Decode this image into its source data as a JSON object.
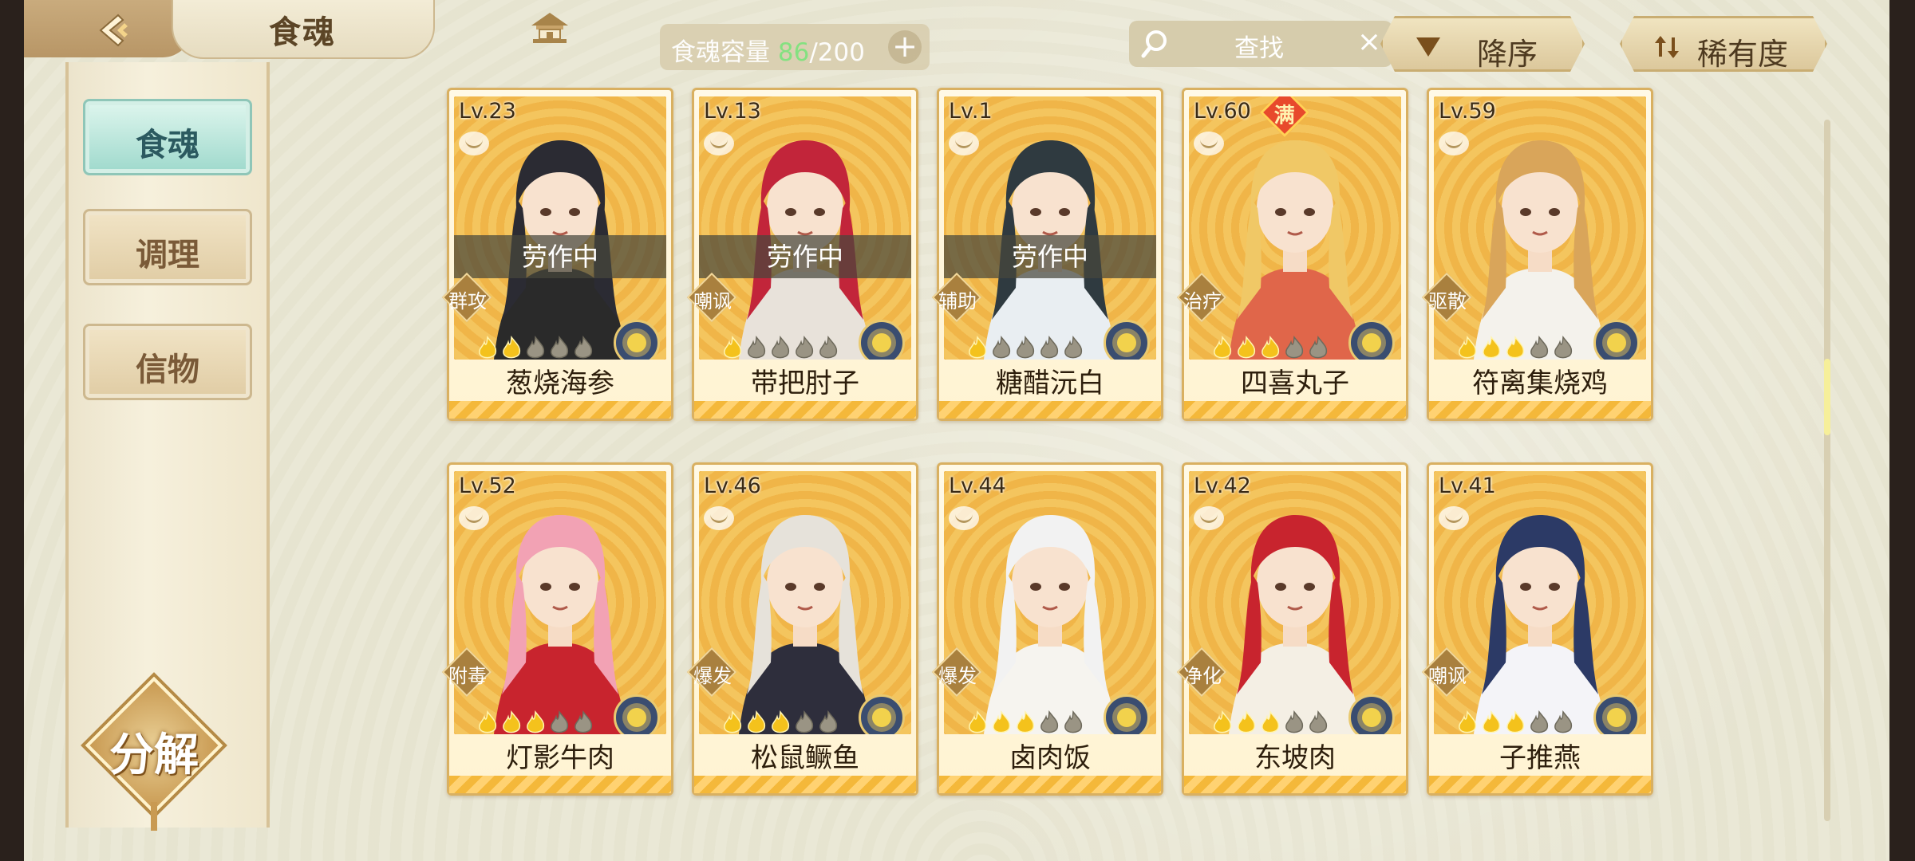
{
  "header": {
    "title": "食魂",
    "capacity_label": "食魂容量",
    "capacity_current": "86",
    "capacity_max": "/200",
    "capacity_add": "+",
    "search_placeholder": "查找",
    "search_clear": "×",
    "sort_order_label": "降序",
    "sort_key_label": "稀有度"
  },
  "sidebar": {
    "items": [
      {
        "label": "食魂",
        "active": true
      },
      {
        "label": "调理",
        "active": false
      },
      {
        "label": "信物",
        "active": false
      }
    ],
    "decompose_label": "分解"
  },
  "colors": {
    "capacity_current": "#7ce17a",
    "active_tab": "#9ed9cc",
    "card_border": "#d9b061",
    "full_badge": "#e84a2c",
    "art_background": "#f4c55e"
  },
  "cards": [
    {
      "level": "Lv.23",
      "name": "葱烧海参",
      "role": "群攻",
      "status": "劳作中",
      "stars": 2,
      "max_stars": 5,
      "full_badge": "",
      "hair": "#2b2b33",
      "outfit": "#2a2a2a",
      "emblem_color": "#3a4d70"
    },
    {
      "level": "Lv.13",
      "name": "带把肘子",
      "role": "嘲讽",
      "status": "劳作中",
      "stars": 1,
      "max_stars": 5,
      "full_badge": "",
      "hair": "#c2253a",
      "outfit": "#e8e2da",
      "emblem_color": "#3a4d70"
    },
    {
      "level": "Lv.1",
      "name": "糖醋沅白",
      "role": "辅助",
      "status": "劳作中",
      "stars": 1,
      "max_stars": 5,
      "full_badge": "",
      "hair": "#2f3a40",
      "outfit": "#e9eef2",
      "emblem_color": "#3a4d70"
    },
    {
      "level": "Lv.60",
      "name": "四喜丸子",
      "role": "治疗",
      "status": "",
      "stars": 3,
      "max_stars": 5,
      "full_badge": "满",
      "hair": "#f0c866",
      "outfit": "#e0664a",
      "emblem_color": "#3a4d70"
    },
    {
      "level": "Lv.59",
      "name": "符离集烧鸡",
      "role": "驱散",
      "status": "",
      "stars": 3,
      "max_stars": 5,
      "full_badge": "",
      "hair": "#d9a55a",
      "outfit": "#f4f2ec",
      "emblem_color": "#3a4d70"
    },
    {
      "level": "Lv.52",
      "name": "灯影牛肉",
      "role": "附毒",
      "status": "",
      "stars": 3,
      "max_stars": 5,
      "full_badge": "",
      "hair": "#f2a2b4",
      "outfit": "#c8242e",
      "emblem_color": "#3a4d70"
    },
    {
      "level": "Lv.46",
      "name": "松鼠鳜鱼",
      "role": "爆发",
      "status": "",
      "stars": 3,
      "max_stars": 5,
      "full_badge": "",
      "hair": "#e6e2da",
      "outfit": "#2e2e3c",
      "emblem_color": "#3a4d70"
    },
    {
      "level": "Lv.44",
      "name": "卤肉饭",
      "role": "爆发",
      "status": "",
      "stars": 3,
      "max_stars": 5,
      "full_badge": "",
      "hair": "#f2f2f2",
      "outfit": "#f6f4ef",
      "emblem_color": "#3a4d70"
    },
    {
      "level": "Lv.42",
      "name": "东坡肉",
      "role": "净化",
      "status": "",
      "stars": 3,
      "max_stars": 5,
      "full_badge": "",
      "hair": "#c8242e",
      "outfit": "#f4efe4",
      "emblem_color": "#3a4d70"
    },
    {
      "level": "Lv.41",
      "name": "子推燕",
      "role": "嘲讽",
      "status": "",
      "stars": 3,
      "max_stars": 5,
      "full_badge": "",
      "hair": "#2c3a66",
      "outfit": "#f4f4f8",
      "emblem_color": "#3a4d70"
    }
  ]
}
